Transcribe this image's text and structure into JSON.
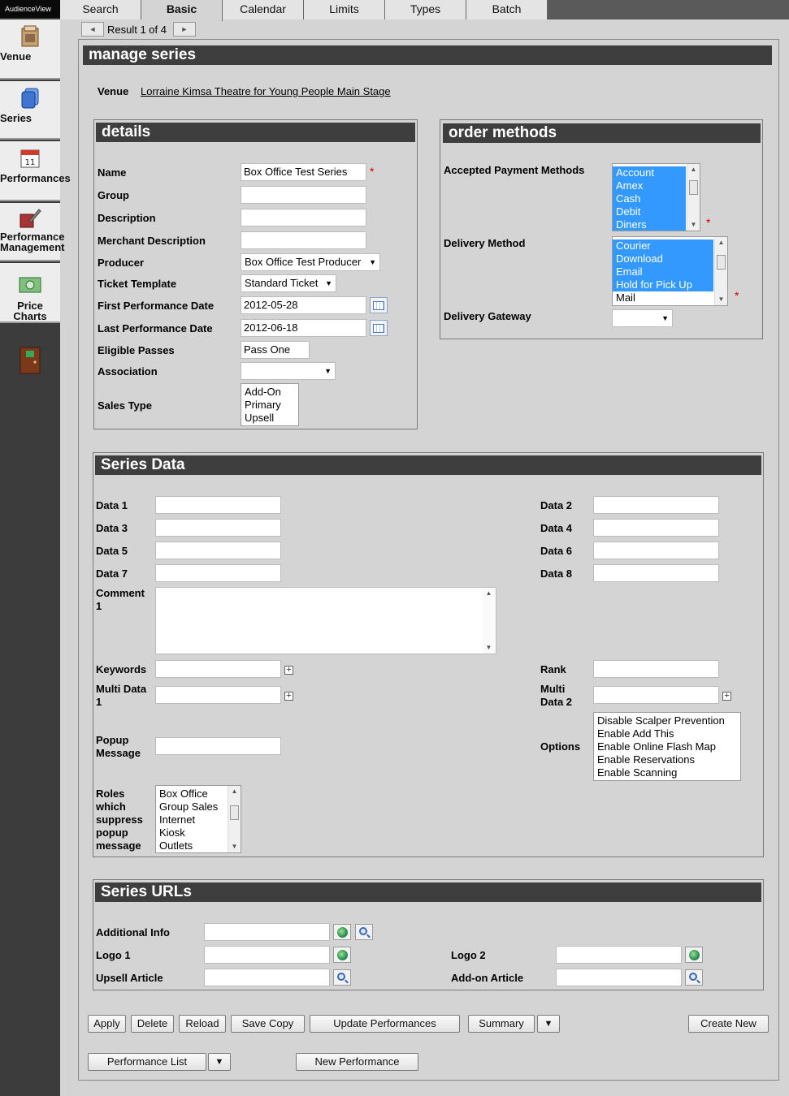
{
  "app": {
    "brand": "AudienceView"
  },
  "rail": [
    {
      "label": "Venue",
      "icon": "venue-icon"
    },
    {
      "label": "Series",
      "icon": "series-icon"
    },
    {
      "label": "Performances",
      "icon": "performances-icon"
    },
    {
      "label": "Performance Management",
      "icon": "performance-management-icon"
    },
    {
      "label": "Price Charts",
      "icon": "price-charts-icon"
    }
  ],
  "tabs": [
    "Search",
    "Basic",
    "Calendar",
    "Limits",
    "Types",
    "Batch"
  ],
  "active_tab": "Basic",
  "pager": {
    "text": "Result 1 of 4",
    "prev": "◄",
    "next": "►"
  },
  "page": {
    "title": "manage series"
  },
  "venue": {
    "label": "Venue",
    "value": "Lorraine Kimsa Theatre for Young People Main Stage"
  },
  "details": {
    "title": "details",
    "name_label": "Name",
    "name_value": "Box Office Test Series",
    "group_label": "Group",
    "group_value": "",
    "description_label": "Description",
    "description_value": "",
    "merchant_label": "Merchant Description",
    "merchant_value": "",
    "producer_label": "Producer",
    "producer_value": "Box Office Test Producer",
    "ticket_template_label": "Ticket Template",
    "ticket_template_value": "Standard Ticket",
    "first_perf_label": "First Performance Date",
    "first_perf_value": "2012-05-28",
    "last_perf_label": "Last Performance Date",
    "last_perf_value": "2012-06-18",
    "passes_label": "Eligible Passes",
    "passes_value": "Pass One",
    "association_label": "Association",
    "association_value": "",
    "sales_type_label": "Sales Type",
    "sales_types": [
      "Add-On",
      "Primary",
      "Upsell"
    ],
    "required_mark": "*"
  },
  "order_methods": {
    "title": "order methods",
    "payment_label": "Accepted Payment Methods",
    "payment_methods": [
      "Account",
      "Amex",
      "Cash",
      "Debit",
      "Diners"
    ],
    "delivery_label": "Delivery Method",
    "delivery_methods": [
      "Courier",
      "Download",
      "Email",
      "Hold for Pick Up",
      "Mail"
    ],
    "gateway_label": "Delivery Gateway",
    "gateway_value": "",
    "required_mark": "*"
  },
  "series_data": {
    "title": "Series Data",
    "data1": "Data 1",
    "data2": "Data 2",
    "data3": "Data 3",
    "data4": "Data 4",
    "data5": "Data 5",
    "data6": "Data 6",
    "data7": "Data 7",
    "data8": "Data 8",
    "comment_label_1": "Comment",
    "comment_label_2": "1",
    "keywords_label": "Keywords",
    "multi1_label_1": "Multi Data",
    "multi1_label_2": "1",
    "rank_label": "Rank",
    "multi2_label_1": "Multi",
    "multi2_label_2": "Data 2",
    "popup_label_1": "Popup",
    "popup_label_2": "Message",
    "options_label": "Options",
    "options": [
      "Disable Scalper Prevention",
      "Enable Add This",
      "Enable Online Flash Map",
      "Enable Reservations",
      "Enable Scanning"
    ],
    "roles_label": [
      "Roles",
      "which",
      "suppress",
      "popup",
      "message"
    ],
    "roles": [
      "Box Office",
      "Group Sales",
      "Internet",
      "Kiosk",
      "Outlets"
    ]
  },
  "series_urls": {
    "title": "Series URLs",
    "additional_label": "Additional Info",
    "logo1_label": "Logo 1",
    "logo2_label": "Logo 2",
    "upsell_label": "Upsell Article",
    "addon_label": "Add-on Article"
  },
  "buttons": {
    "apply": "Apply",
    "delete": "Delete",
    "reload": "Reload",
    "save_copy": "Save Copy",
    "update_performances": "Update Performances",
    "summary": "Summary",
    "dropdown": "▼",
    "create_new": "Create New",
    "performance_list": "Performance List",
    "new_performance": "New Performance"
  }
}
